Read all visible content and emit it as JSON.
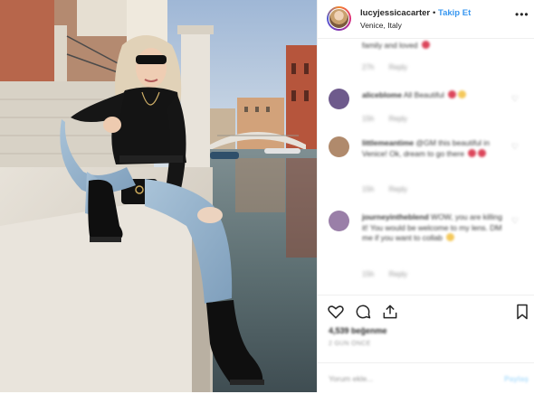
{
  "post": {
    "photo_description_icon": "photo",
    "header": {
      "username": "lucyjessicacarter",
      "separator": "•",
      "follow_label": "Takip Et",
      "location": "Venice, Italy",
      "more_icon": "ellipsis-icon",
      "more_label": "•••"
    },
    "comments": [
      {
        "user": "",
        "text": "family and loved",
        "meta": [
          "27h",
          "Reply"
        ],
        "emoji": "heart"
      },
      {
        "user": "aliceblome",
        "text": "All Beautiful",
        "meta": [
          "15h",
          "Reply"
        ],
        "emoji": "heart-face"
      },
      {
        "user": "littlemeantime",
        "text": "@GM this beautiful in Venice! Ok, dream to go there",
        "meta": [
          "15h",
          "Reply"
        ],
        "emoji": "hearts"
      },
      {
        "user": "journeyintheblend",
        "text": "WOW, you are killing it! You would be welcome to my lens. DM me if you want to collab",
        "meta": [
          "15h",
          "Reply"
        ],
        "emoji": "smile"
      }
    ],
    "actions": {
      "icons": [
        "heart-icon",
        "comment-icon",
        "share-icon",
        "bookmark-icon"
      ],
      "likes": "4,539 beğenme",
      "time": "2 GÜN ÖNCE",
      "add_comment_placeholder": "Yorum ekle...",
      "post_label": "Paylaş"
    }
  }
}
